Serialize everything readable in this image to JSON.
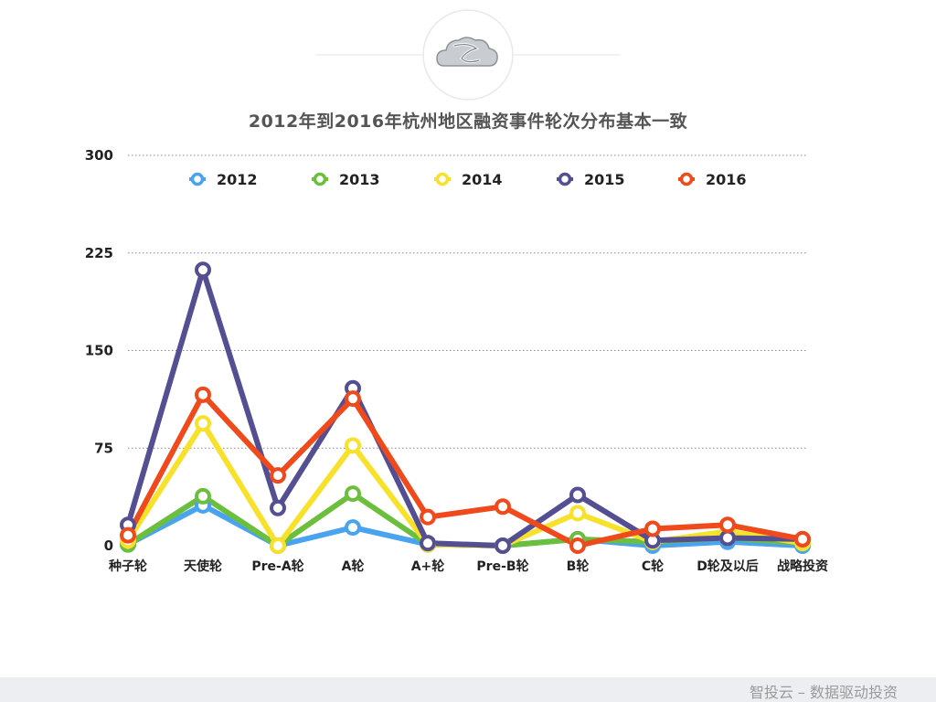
{
  "footer": {
    "text": "智投云 – 数据驱动投资"
  },
  "logo": {
    "icon": "cloud-logo-icon"
  },
  "colors": {
    "2012": "#4aa3ee",
    "2013": "#6cbf3d",
    "2014": "#f7e12a",
    "2015": "#544f93",
    "2016": "#f0491c"
  },
  "chart_data": {
    "type": "line",
    "title": "2012年到2016年杭州地区融资事件轮次分布基本一致",
    "xlabel": "",
    "ylabel": "",
    "ylim": [
      0,
      300
    ],
    "yticks": [
      0,
      75,
      150,
      225,
      300
    ],
    "grid": true,
    "legend_position": "top",
    "categories": [
      "种子轮",
      "天使轮",
      "Pre-A轮",
      "A轮",
      "A+轮",
      "Pre-B轮",
      "B轮",
      "C轮",
      "D轮及以后",
      "战略投资"
    ],
    "series": [
      {
        "name": "2012",
        "values": [
          1,
          31,
          0,
          14,
          1,
          0,
          5,
          0,
          3,
          0
        ]
      },
      {
        "name": "2013",
        "values": [
          1,
          38,
          0,
          40,
          1,
          0,
          5,
          3,
          6,
          2
        ]
      },
      {
        "name": "2014",
        "values": [
          4,
          94,
          0,
          77,
          1,
          0,
          25,
          3,
          11,
          2
        ]
      },
      {
        "name": "2015",
        "values": [
          16,
          212,
          29,
          121,
          2,
          0,
          39,
          4,
          6,
          5
        ]
      },
      {
        "name": "2016",
        "values": [
          8,
          116,
          54,
          113,
          22,
          30,
          0,
          13,
          16,
          5
        ]
      }
    ]
  }
}
